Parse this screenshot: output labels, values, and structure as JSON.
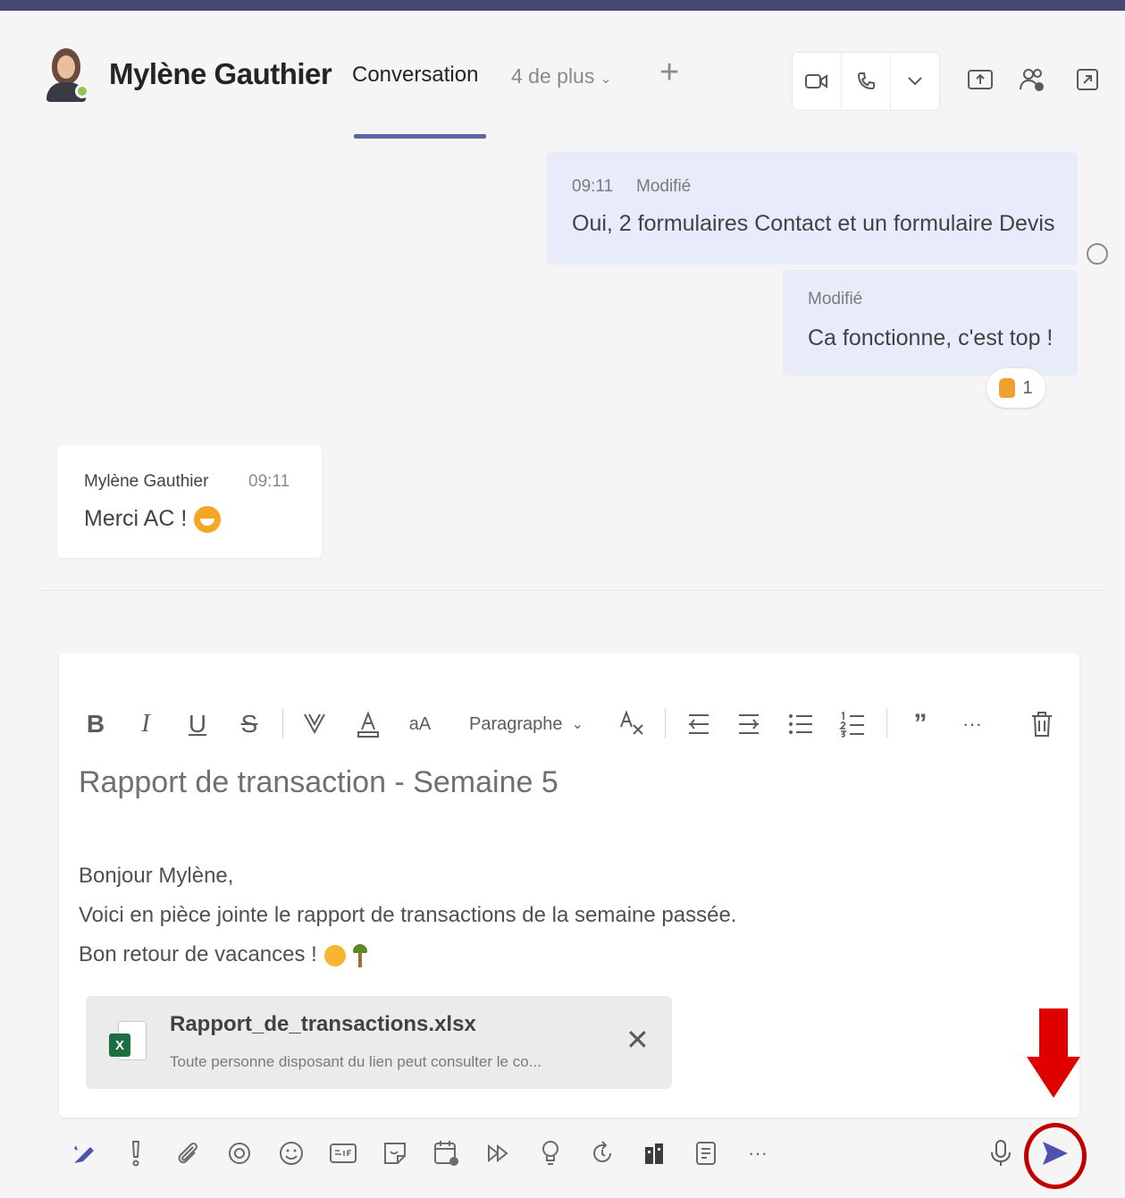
{
  "header": {
    "contact_name": "Mylène Gauthier",
    "tab_conversation": "Conversation",
    "tab_more": "4 de plus",
    "tab_add": "+"
  },
  "messages": {
    "sent_1": {
      "time": "09:11",
      "status": "Modifié",
      "text": "Oui, 2 formulaires Contact et un formulaire Devis"
    },
    "sent_2": {
      "status": "Modifié",
      "text": "Ca fonctionne, c'est top !",
      "reaction_count": "1"
    },
    "received_1": {
      "sender": "Mylène Gauthier",
      "time": "09:11",
      "text": "Merci AC !"
    }
  },
  "compose": {
    "toolbar": {
      "paragraph_label": "Paragraphe"
    },
    "subject": "Rapport de transaction - Semaine 5",
    "body_lines": [
      "Bonjour Mylène,",
      "Voici en pièce jointe le rapport de transactions de la semaine passée.",
      "Bon retour de vacances !"
    ],
    "attachment": {
      "file_name": "Rapport_de_transactions.xlsx",
      "description": "Toute personne disposant du lien peut consulter le co...",
      "badge": "X"
    }
  },
  "colors": {
    "accent": "#6264a7",
    "highlight_annotation": "#e00000",
    "sent_bubble": "#e8ebfa"
  }
}
